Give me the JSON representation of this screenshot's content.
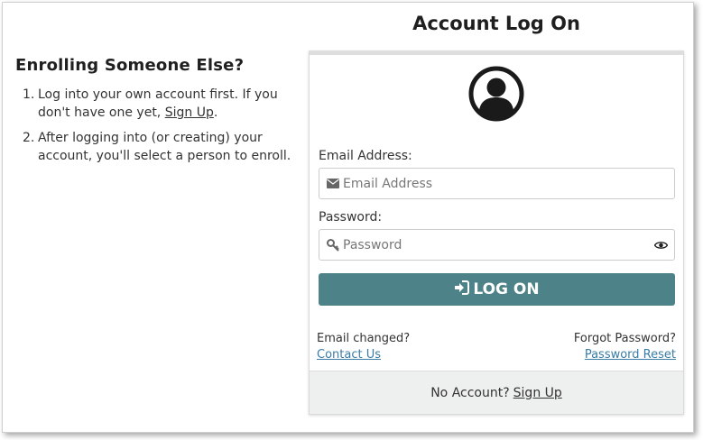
{
  "page": {
    "title": "Account Log On"
  },
  "left_panel": {
    "title": "Enrolling Someone Else?",
    "steps": [
      {
        "num": "1.",
        "text_before": "Log into your own account first. If you don't have one yet, ",
        "link": "Sign Up",
        "text_after": "."
      },
      {
        "num": "2.",
        "text": "After logging into (or creating) your account, you'll select a person to enroll."
      }
    ]
  },
  "form": {
    "avatar_icon": "user-circle-icon",
    "email_label": "Email Address:",
    "email_placeholder": "Email Address",
    "email_icon": "envelope-icon",
    "password_label": "Password:",
    "password_placeholder": "Password",
    "password_icon": "key-icon",
    "show_password_icon": "eye-icon",
    "logon_button": "LOG ON",
    "logon_icon": "sign-in-icon"
  },
  "help": {
    "email_changed_text": "Email changed?",
    "contact_link": "Contact Us",
    "forgot_text": "Forgot Password?",
    "reset_link": "Password Reset"
  },
  "footer": {
    "no_account_text": "No Account?",
    "signup_link": "Sign Up"
  },
  "colors": {
    "button": "#4e8289",
    "link": "#3a7ca5",
    "footer_bg": "#eeefef"
  }
}
